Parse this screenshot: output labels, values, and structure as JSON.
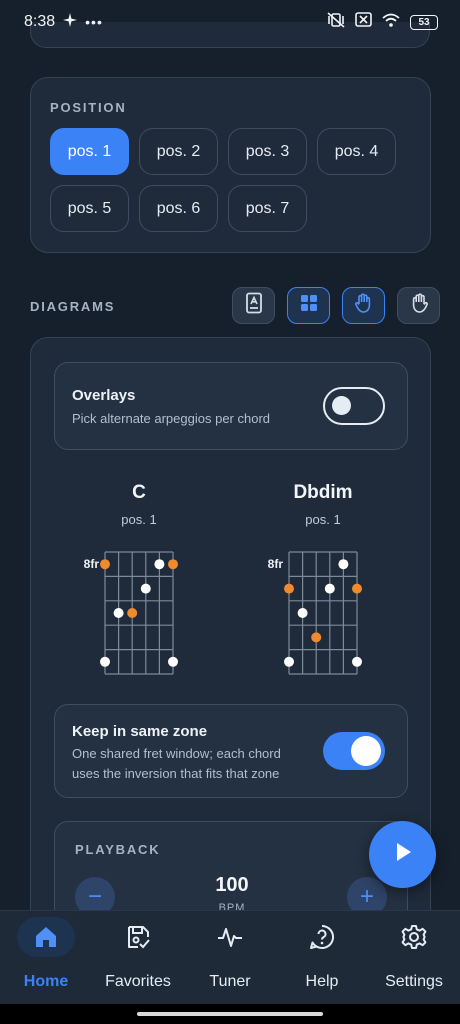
{
  "status_bar": {
    "time": "8:38",
    "battery": "53"
  },
  "position": {
    "label": "POSITION",
    "options": [
      "pos. 1",
      "pos. 2",
      "pos. 3",
      "pos. 4",
      "pos. 5",
      "pos. 6",
      "pos. 7"
    ],
    "selected": "pos. 1"
  },
  "diagrams": {
    "label": "DIAGRAMS",
    "overlays": {
      "title": "Overlays",
      "subtitle": "Pick alternate arpeggios per chord",
      "enabled": false
    },
    "chords": [
      {
        "name": "C",
        "position": "pos. 1",
        "fret_label": "8fr",
        "dots": [
          {
            "string": 1,
            "fret": 1,
            "color": "orange"
          },
          {
            "string": 5,
            "fret": 1,
            "color": "white"
          },
          {
            "string": 6,
            "fret": 1,
            "color": "orange"
          },
          {
            "string": 4,
            "fret": 2,
            "color": "white"
          },
          {
            "string": 2,
            "fret": 3,
            "color": "white"
          },
          {
            "string": 3,
            "fret": 3,
            "color": "orange"
          },
          {
            "string": 1,
            "fret": 5,
            "color": "white"
          },
          {
            "string": 6,
            "fret": 5,
            "color": "white"
          }
        ]
      },
      {
        "name": "Dbdim",
        "position": "pos. 1",
        "fret_label": "8fr",
        "dots": [
          {
            "string": 5,
            "fret": 1,
            "color": "white"
          },
          {
            "string": 1,
            "fret": 2,
            "color": "orange"
          },
          {
            "string": 4,
            "fret": 2,
            "color": "white"
          },
          {
            "string": 6,
            "fret": 2,
            "color": "orange"
          },
          {
            "string": 2,
            "fret": 3,
            "color": "white"
          },
          {
            "string": 3,
            "fret": 4,
            "color": "orange"
          },
          {
            "string": 1,
            "fret": 5,
            "color": "white"
          },
          {
            "string": 6,
            "fret": 5,
            "color": "white"
          }
        ]
      }
    ],
    "zone": {
      "title": "Keep in same zone",
      "subtitle_line1": "One shared fret window; each chord",
      "subtitle_line2": "uses the inversion that fits that zone",
      "enabled": true
    }
  },
  "playback": {
    "label": "PLAYBACK",
    "bpm": "100",
    "bpm_unit": "BPM",
    "minus": "−",
    "plus": "+"
  },
  "nav": {
    "items": [
      {
        "label": "Home",
        "icon": "home-icon",
        "active": true
      },
      {
        "label": "Favorites",
        "icon": "save-icon",
        "active": false
      },
      {
        "label": "Tuner",
        "icon": "waveform-icon",
        "active": false
      },
      {
        "label": "Help",
        "icon": "help-icon",
        "active": false
      },
      {
        "label": "Settings",
        "icon": "gear-icon",
        "active": false
      }
    ]
  },
  "colors": {
    "accent": "#3b82f6",
    "orange_dot": "#f08a2c",
    "white_dot": "#ffffff",
    "background": "#16202c"
  }
}
